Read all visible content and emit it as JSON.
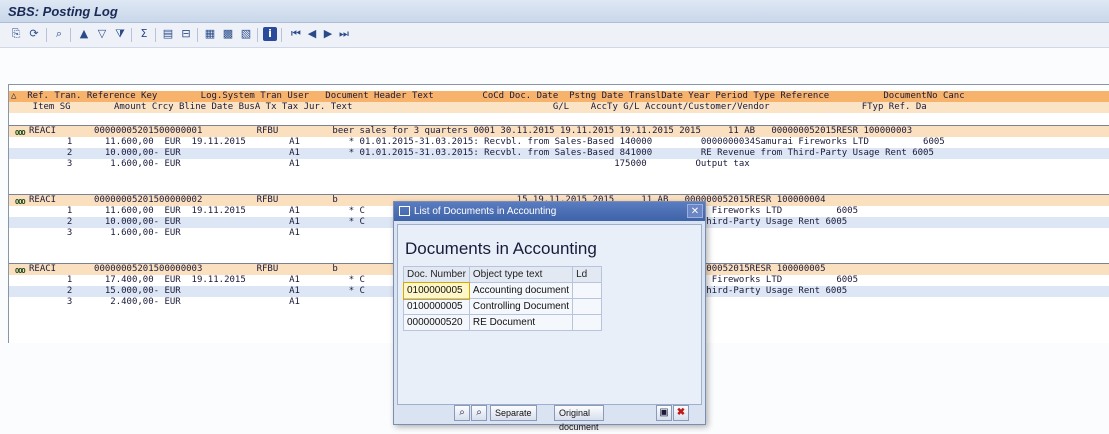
{
  "window": {
    "title": "SBS: Posting Log"
  },
  "toolbar": {
    "icons": [
      "detail-icon",
      "refresh-icon",
      "find-icon",
      "sort-ascending-icon",
      "sort-descending-icon",
      "filter-icon",
      "sum-icon",
      "print-preview-icon",
      "export-icon",
      "layout-icon",
      "select-layout-icon",
      "save-layout-icon",
      "info-icon",
      "first-page-icon",
      "previous-page-icon",
      "next-page-icon",
      "last-page-icon"
    ]
  },
  "header": {
    "line1": "△  Ref. Tran. Reference Key        Log.System Tran User   Document Header Text         CoCd Doc. Date  Pstng Date TranslDate Year Period Type Reference          DocumentNo Canc",
    "line2": "    Item SG        Amount Crcy Bline Date BusA Tx Tax Jur. Text                                     G/L    AccTy G/L Account/Customer/Vendor                 FTyp Ref. Da"
  },
  "documents": [
    {
      "doc_line": "REACI       00000005201500000001          RFBU          beer sales for 3 quarters 0001 30.11.2015 19.11.2015 19.11.2015 2015     11 AB   000000052015RESR 100000003",
      "items": [
        "       1      11.600,00  EUR  19.11.2015        A1         * 01.01.2015-31.03.2015: Recvbl. from Sales-Based 140000         0000000034Samurai Fireworks LTD          6005",
        "       2      10.000,00- EUR                    A1         * 01.01.2015-31.03.2015: Recvbl. from Sales-Based 841000         RE Revenue from Third-Party Usage Rent 6005",
        "       3       1.600,00- EUR                    A1                                                          175000         Output tax"
      ]
    },
    {
      "doc_line": "REACI       00000005201500000002          RFBU          b                                 15 19.11.2015 2015     11 AB   000000052015RESR 100000004",
      "items": [
        "       1      11.600,00  EUR  19.11.2015        A1         * C                                 0000         0000000034Samurai Fireworks LTD          6005",
        "       2      10.000,00- EUR                    A1         * C                                 1000         RE Revenue from Third-Party Usage Rent 6005",
        "       3       1.600,00- EUR                    A1                                             5000         Output tax"
      ]
    },
    {
      "doc_line": "REACI       00000005201500000003          RFBU          b                                 15 19.11.2015 2015     11 AB   000000052015RESR 100000005",
      "items": [
        "       1      17.400,00  EUR  19.11.2015        A1         * C                                 0000         0000000034Samurai Fireworks LTD          6005",
        "       2      15.000,00- EUR                    A1         * C                                 1000         RE Revenue from Third-Party Usage Rent 6005",
        "       3       2.400,00- EUR                    A1                                             5000         Output tax"
      ]
    }
  ],
  "popup": {
    "title": "List of Documents in Accounting",
    "heading": "Documents in Accounting",
    "columns": [
      "Doc. Number",
      "Object type text",
      "Ld"
    ],
    "rows": [
      {
        "doc_number": "0100000005",
        "object_type": "Accounting document",
        "ld": ""
      },
      {
        "doc_number": "0100000005",
        "object_type": "Controlling Document",
        "ld": ""
      },
      {
        "doc_number": "0000000520",
        "object_type": "RE Document",
        "ld": ""
      }
    ],
    "buttons": {
      "separate": "Separate",
      "original": "Original document"
    }
  }
}
